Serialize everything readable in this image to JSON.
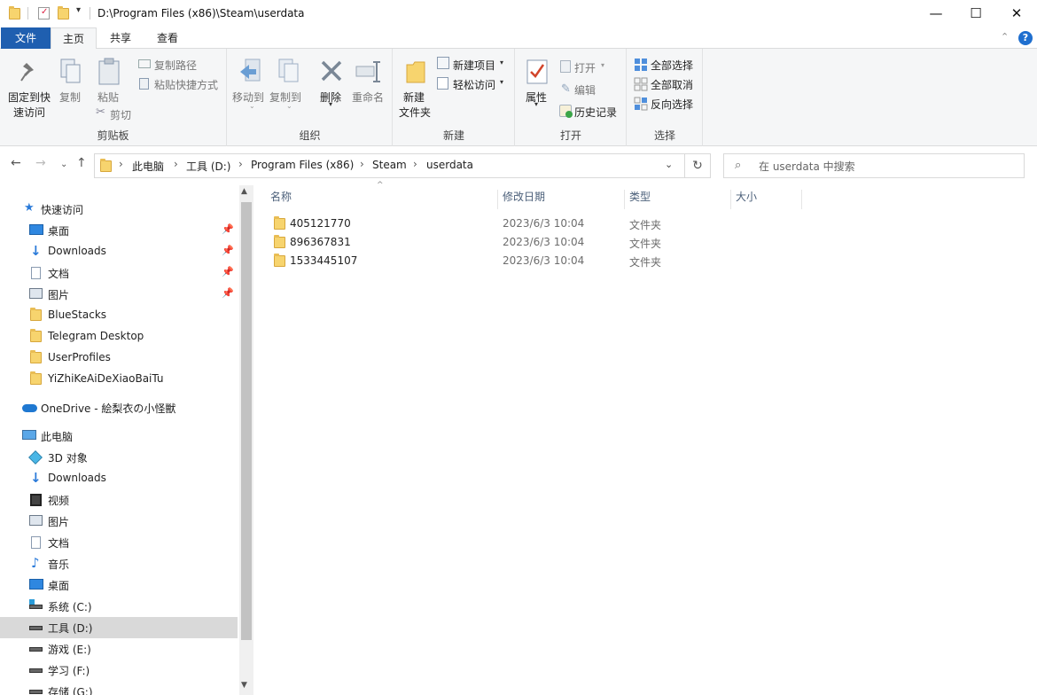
{
  "window": {
    "path": "D:\\Program Files (x86)\\Steam\\userdata",
    "minimize": "—",
    "maximize": "☐",
    "close": "✕"
  },
  "tabs": {
    "file": "文件",
    "home": "主页",
    "share": "共享",
    "view": "查看"
  },
  "ribbon": {
    "pin_quick": "固定到快",
    "pin_quick2": "速访问",
    "copy": "复制",
    "paste": "粘贴",
    "copy_path": "复制路径",
    "paste_shortcut": "粘贴快捷方式",
    "cut": "剪切",
    "clipboard": "剪贴板",
    "move_to": "移动到",
    "copy_to": "复制到",
    "delete": "删除",
    "rename": "重命名",
    "organize": "组织",
    "new_folder": "新建",
    "new_folder2": "文件夹",
    "new_item": "新建项目",
    "easy_access": "轻松访问",
    "new": "新建",
    "properties": "属性",
    "open": "打开",
    "edit": "编辑",
    "history": "历史记录",
    "open_group": "打开",
    "select_all": "全部选择",
    "select_none": "全部取消",
    "invert": "反向选择",
    "select": "选择"
  },
  "breadcrumbs": [
    "此电脑",
    "工具 (D:)",
    "Program Files (x86)",
    "Steam",
    "userdata"
  ],
  "search": {
    "placeholder": "在 userdata 中搜索"
  },
  "nav": {
    "quick_access": "快速访问",
    "qa": [
      {
        "label": "桌面"
      },
      {
        "label": "Downloads"
      },
      {
        "label": "文档"
      },
      {
        "label": "图片"
      },
      {
        "label": "BlueStacks"
      },
      {
        "label": "Telegram Desktop"
      },
      {
        "label": "UserProfiles"
      },
      {
        "label": "YiZhiKeAiDeXiaoBaiTu"
      }
    ],
    "onedrive": "OneDrive - 絵梨衣の小怪獣",
    "this_pc": "此电脑",
    "pc": [
      {
        "label": "3D 对象"
      },
      {
        "label": "Downloads"
      },
      {
        "label": "视频"
      },
      {
        "label": "图片"
      },
      {
        "label": "文档"
      },
      {
        "label": "音乐"
      },
      {
        "label": "桌面"
      },
      {
        "label": "系统 (C:)"
      },
      {
        "label": "工具 (D:)"
      },
      {
        "label": "游戏 (E:)"
      },
      {
        "label": "学习 (F:)"
      },
      {
        "label": "存储 (G:)"
      }
    ]
  },
  "columns": {
    "name": "名称",
    "date": "修改日期",
    "type": "类型",
    "size": "大小"
  },
  "files": [
    {
      "name": "405121770",
      "date": "2023/6/3 10:04",
      "type": "文件夹"
    },
    {
      "name": "896367831",
      "date": "2023/6/3 10:04",
      "type": "文件夹"
    },
    {
      "name": "1533445107",
      "date": "2023/6/3 10:04",
      "type": "文件夹"
    }
  ]
}
